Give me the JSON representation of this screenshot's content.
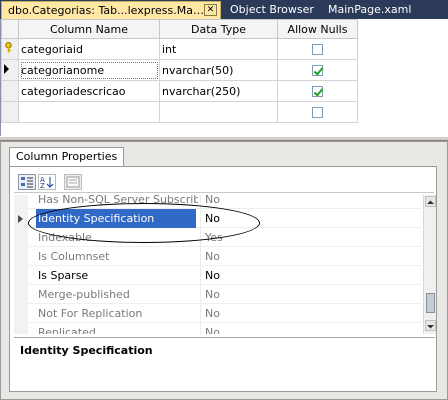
{
  "tabs": [
    {
      "label": "dbo.Categorias: Tab...lexpress.Macoratti)",
      "active": true
    },
    {
      "label": "Object Browser",
      "active": false
    },
    {
      "label": "MainPage.xaml",
      "active": false
    }
  ],
  "close_glyph": "✕",
  "table_designer": {
    "headers": {
      "column_name": "Column Name",
      "data_type": "Data Type",
      "allow_nulls": "Allow Nulls"
    },
    "rows": [
      {
        "name": "categoriaid",
        "type": "int",
        "allow_nulls": false,
        "marker": "key-icon"
      },
      {
        "name": "categorianome",
        "type": "nvarchar(50)",
        "allow_nulls": true,
        "marker": "current-row-arrow-icon",
        "selected": true
      },
      {
        "name": "categoriadescricao",
        "type": "nvarchar(250)",
        "allow_nulls": true,
        "marker": ""
      },
      {
        "name": "",
        "type": "",
        "allow_nulls": false,
        "marker": ""
      }
    ]
  },
  "column_properties": {
    "tab_label": "Column Properties",
    "properties": [
      {
        "name": "Has Non-SQL Server Subscriber",
        "value": "No",
        "style": "gray"
      },
      {
        "name": "Identity Specification",
        "value": "No",
        "style": "highlighted",
        "expandable": true
      },
      {
        "name": "Indexable",
        "value": "Yes",
        "style": "gray"
      },
      {
        "name": "Is Columnset",
        "value": "No",
        "style": "gray"
      },
      {
        "name": "Is Sparse",
        "value": "No",
        "style": "normal"
      },
      {
        "name": "Merge-published",
        "value": "No",
        "style": "gray"
      },
      {
        "name": "Not For Replication",
        "value": "No",
        "style": "gray"
      },
      {
        "name": "Replicated",
        "value": "No",
        "style": "gray"
      }
    ],
    "description_title": "Identity Specification"
  },
  "colors": {
    "selection": "#3169c6",
    "active_tab": "#ffe8a6",
    "frame": "#2b3a58"
  }
}
